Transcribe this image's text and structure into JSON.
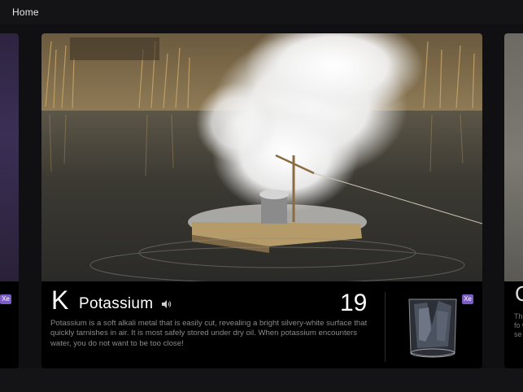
{
  "nav": {
    "home_label": "Home"
  },
  "element": {
    "symbol": "K",
    "name": "Potassium",
    "atomic_number": "19",
    "description": "Potassium is a soft alkali metal that is easily cut, revealing a bright silvery-white surface that quickly tarnishes in air. It is most safely stored under dry oil. When potassium encounters water, you do not want to be too close!"
  },
  "thumbnail_badge": "Xe",
  "left_card": {
    "badge": "Xe"
  },
  "right_card": {
    "symbol": "C",
    "snippet": "Th fo w se"
  },
  "colors": {
    "badge": "#7b5bc4",
    "background": "#101012",
    "description_text": "#8a8a8a"
  }
}
